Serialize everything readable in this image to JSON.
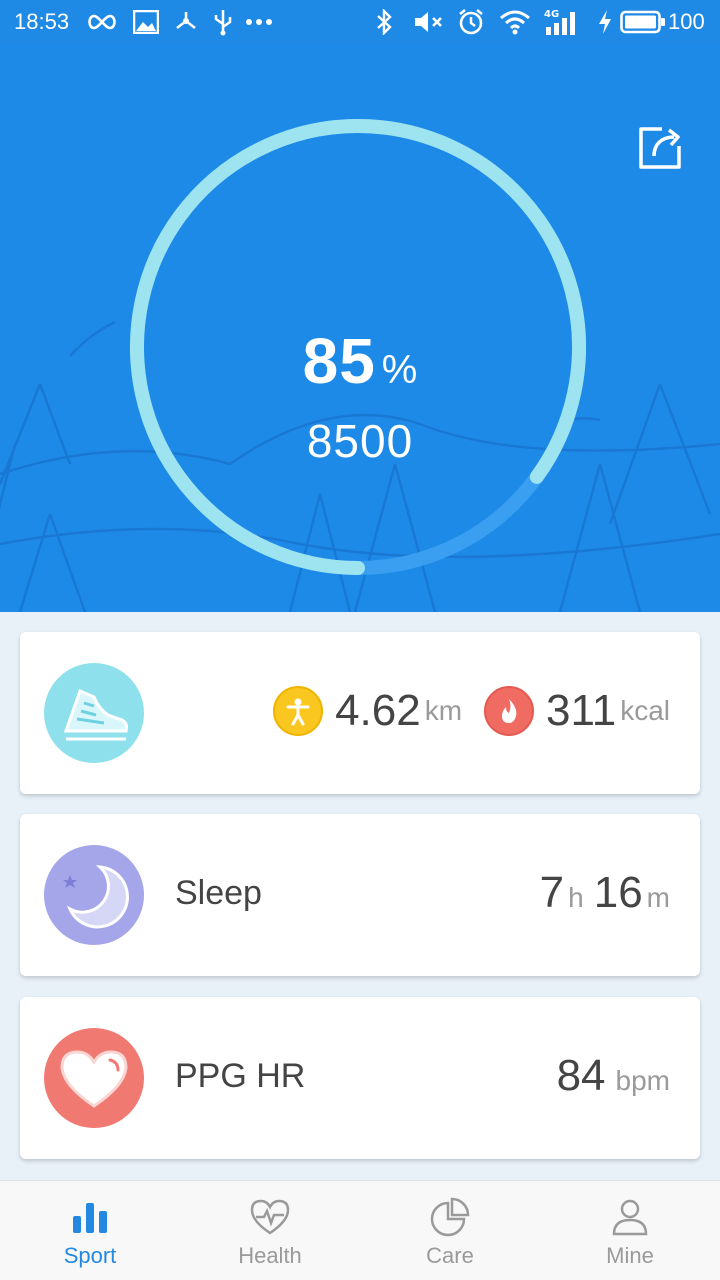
{
  "status_bar": {
    "time": "18:53",
    "battery": "100",
    "icons": [
      "infinity-icon",
      "image-icon",
      "share-nodes-icon",
      "usb-icon",
      "more-icon",
      "bluetooth-icon",
      "mute-icon",
      "alarm-icon",
      "wifi-icon",
      "signal-4g-icon",
      "charging-icon",
      "battery-icon"
    ]
  },
  "hero": {
    "percent_value": "85",
    "percent_unit": "%",
    "steps": "8500",
    "progress": 0.85,
    "colors": {
      "background": "#1e8ae8",
      "ring": "#9ee4f0"
    }
  },
  "activity": {
    "distance_value": "4.62",
    "distance_unit": "km",
    "calories_value": "311",
    "calories_unit": "kcal"
  },
  "sleep": {
    "label": "Sleep",
    "hours": "7",
    "hours_unit": "h",
    "minutes": "16",
    "minutes_unit": "m"
  },
  "heart": {
    "label": "PPG HR",
    "value": "84",
    "unit": "bpm"
  },
  "tabs": [
    {
      "label": "Sport",
      "icon": "bar-chart-icon",
      "active": true
    },
    {
      "label": "Health",
      "icon": "heart-pulse-icon",
      "active": false
    },
    {
      "label": "Care",
      "icon": "pie-chart-icon",
      "active": false
    },
    {
      "label": "Mine",
      "icon": "person-icon",
      "active": false
    }
  ],
  "accent_color": "#2389e0"
}
